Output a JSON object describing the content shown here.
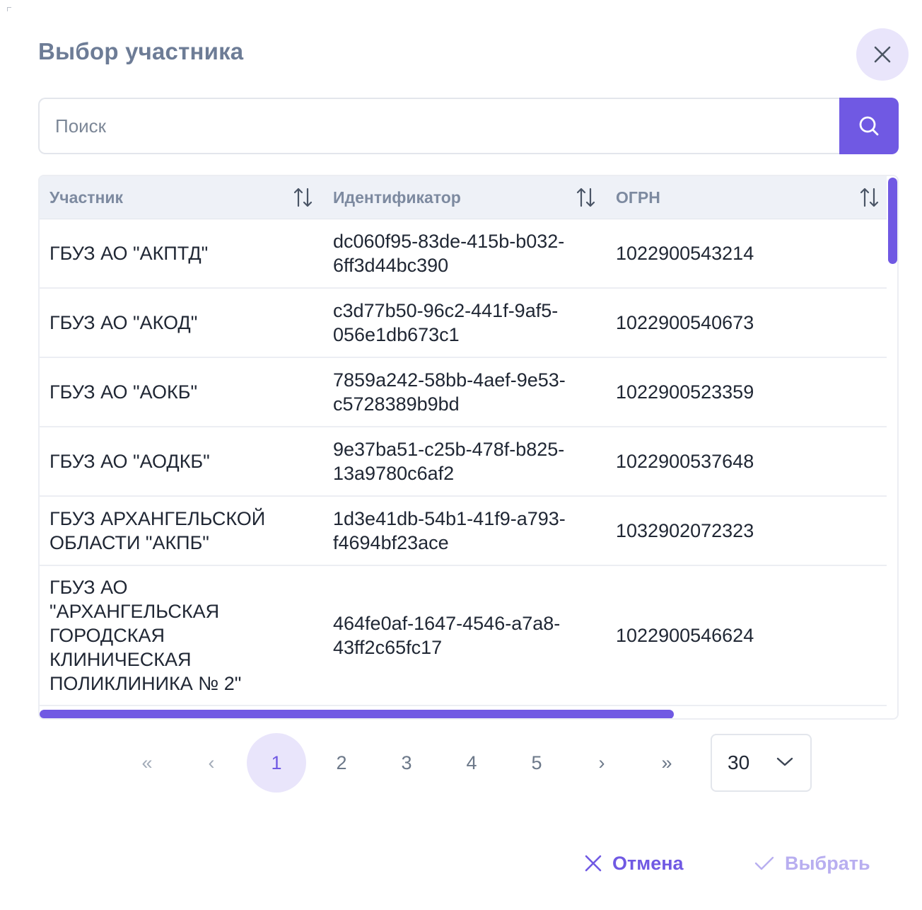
{
  "dialog": {
    "title": "Выбор участника"
  },
  "search": {
    "placeholder": "Поиск",
    "value": ""
  },
  "table": {
    "columns": [
      "Участник",
      "Идентификатор",
      "ОГРН"
    ],
    "rows": [
      {
        "participant": "ГБУЗ АО \"АКПТД\"",
        "id": "dc060f95-83de-415b-b032-6ff3d44bc390",
        "ogrn": "1022900543214"
      },
      {
        "participant": "ГБУЗ АО \"АКОД\"",
        "id": "c3d77b50-96c2-441f-9af5-056e1db673c1",
        "ogrn": "1022900540673"
      },
      {
        "participant": "ГБУЗ АО \"АОКБ\"",
        "id": "7859a242-58bb-4aef-9e53-c5728389b9bd",
        "ogrn": "1022900523359"
      },
      {
        "participant": "ГБУЗ АО \"АОДКБ\"",
        "id": "9e37ba51-c25b-478f-b825-13a9780c6af2",
        "ogrn": "1022900537648"
      },
      {
        "participant": "ГБУЗ АРХАНГЕЛЬСКОЙ ОБЛАСТИ \"АКПБ\"",
        "id": "1d3e41db-54b1-41f9-a793-f4694bf23ace",
        "ogrn": "1032902072323"
      },
      {
        "participant": "ГБУЗ АО \"АРХАНГЕЛЬСКАЯ ГОРОДСКАЯ КЛИНИЧЕСКАЯ ПОЛИКЛИНИКА № 2\"",
        "id": "464fe0af-1647-4546-a7a8-43ff2c65fc17",
        "ogrn": "1022900546624"
      }
    ]
  },
  "pagination": {
    "first": "«",
    "prev": "‹",
    "pages": [
      "1",
      "2",
      "3",
      "4",
      "5"
    ],
    "current": "1",
    "next": "›",
    "last": "»",
    "per_page": "30"
  },
  "footer": {
    "cancel_label": "Отмена",
    "choose_label": "Выбрать"
  },
  "colors": {
    "accent": "#7059e3",
    "accent_light": "#e9e5fb",
    "title": "#6d7c96"
  }
}
